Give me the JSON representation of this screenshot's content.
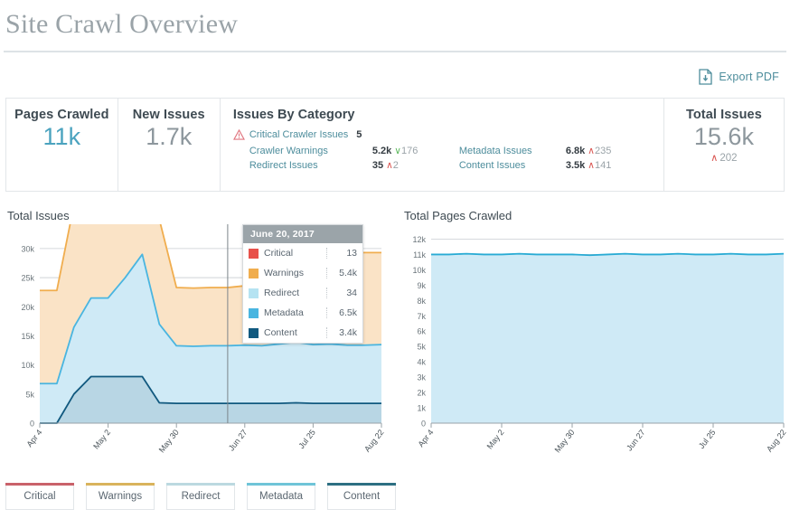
{
  "header": {
    "title": "Site Crawl Overview",
    "export_label": "Export PDF",
    "export_icon": "document-download-icon"
  },
  "stats": {
    "pages_crawled": {
      "label": "Pages Crawled",
      "value": "11k"
    },
    "new_issues": {
      "label": "New Issues",
      "value": "1.7k"
    },
    "total_issues": {
      "label": "Total Issues",
      "value": "15.6k",
      "delta": "202",
      "delta_dir": "up",
      "delta_caret": "∧"
    },
    "category": {
      "title": "Issues By Category",
      "critical": {
        "icon": "warning-triangle-icon",
        "label": "Critical Crawler Issues",
        "value": "5"
      },
      "rows": [
        {
          "label": "Crawler Warnings",
          "value": "5.2k",
          "delta": "176",
          "delta_dir": "down",
          "caret": "∨"
        },
        {
          "label": "Metadata Issues",
          "value": "6.8k",
          "delta": "235",
          "delta_dir": "up",
          "caret": "∧"
        },
        {
          "label": "Redirect Issues",
          "value": "35",
          "delta": "2",
          "delta_dir": "up",
          "caret": "∧"
        },
        {
          "label": "Content Issues",
          "value": "3.5k",
          "delta": "141",
          "delta_dir": "up",
          "caret": "∧"
        }
      ]
    }
  },
  "tooltip": {
    "date": "June 20, 2017",
    "rows": [
      {
        "name": "Critical",
        "value": "13",
        "color": "#e8514a"
      },
      {
        "name": "Warnings",
        "value": "5.4k",
        "color": "#f0ad4e"
      },
      {
        "name": "Redirect",
        "value": "34",
        "color": "#b5e3f2"
      },
      {
        "name": "Metadata",
        "value": "6.5k",
        "color": "#49b5e0"
      },
      {
        "name": "Content",
        "value": "3.4k",
        "color": "#11597f"
      }
    ]
  },
  "legend": [
    {
      "label": "Critical",
      "color": "#c9626a"
    },
    {
      "label": "Warnings",
      "color": "#d9b35c"
    },
    {
      "label": "Redirect",
      "color": "#bcd9e0"
    },
    {
      "label": "Metadata",
      "color": "#6fc4d8"
    },
    {
      "label": "Content",
      "color": "#2d6f82"
    }
  ],
  "chart_data": [
    {
      "id": "total_issues_chart",
      "type": "area",
      "title": "Total Issues",
      "xlabel": "",
      "ylabel": "",
      "grid": true,
      "legend_position": "bottom",
      "stacked": true,
      "ylim": [
        0,
        32000
      ],
      "yticks": [
        "0",
        "5k",
        "10k",
        "15k",
        "20k",
        "25k",
        "30k"
      ],
      "ytick_values": [
        0,
        5000,
        10000,
        15000,
        20000,
        25000,
        30000
      ],
      "xticks": [
        "Apr 4",
        "May 2",
        "May 30",
        "Jun 27",
        "Jul 25",
        "Aug 22"
      ],
      "x": [
        "Apr 4",
        "Apr 11",
        "Apr 18",
        "Apr 25",
        "May 2",
        "May 9",
        "May 16",
        "May 23",
        "May 30",
        "Jun 6",
        "Jun 13",
        "Jun 20",
        "Jun 27",
        "Jul 4",
        "Jul 11",
        "Jul 18",
        "Jul 25",
        "Aug 1",
        "Aug 8",
        "Aug 15",
        "Aug 22"
      ],
      "series": [
        {
          "name": "Content",
          "color": "#11597f",
          "fill": "#b8d6e4",
          "values": [
            0,
            0,
            5000,
            8000,
            8000,
            8000,
            8000,
            3500,
            3400,
            3400,
            3400,
            3400,
            3400,
            3400,
            3400,
            3500,
            3400,
            3400,
            3400,
            3400,
            3400
          ]
        },
        {
          "name": "Metadata",
          "color": "#49b5e0",
          "fill": "#cfeaf6",
          "values": [
            6800,
            6800,
            11500,
            13500,
            13500,
            17000,
            21000,
            13500,
            9900,
            9800,
            9900,
            9900,
            10000,
            9900,
            10200,
            10400,
            10100,
            10200,
            10000,
            10000,
            10100
          ]
        },
        {
          "name": "Warnings",
          "color": "#f0ad4e",
          "fill": "#fae3c6",
          "values": [
            16000,
            16000,
            21000,
            24500,
            24500,
            25000,
            30500,
            18000,
            10000,
            10000,
            10000,
            10000,
            10200,
            10200,
            15800,
            16200,
            16200,
            16000,
            15800,
            15900,
            15800
          ]
        }
      ],
      "tooltip_x": "Jun 20",
      "annotations": {
        "tooltip_date": "June 20, 2017"
      }
    },
    {
      "id": "total_pages_crawled_chart",
      "type": "area",
      "title": "Total Pages Crawled",
      "xlabel": "",
      "ylabel": "",
      "grid": true,
      "ylim": [
        0,
        12500
      ],
      "yticks": [
        "0",
        "1k",
        "2k",
        "3k",
        "4k",
        "5k",
        "6k",
        "7k",
        "8k",
        "9k",
        "10k",
        "11k",
        "12k"
      ],
      "ytick_values": [
        0,
        1000,
        2000,
        3000,
        4000,
        5000,
        6000,
        7000,
        8000,
        9000,
        10000,
        11000,
        12000
      ],
      "xticks": [
        "Apr 4",
        "May 2",
        "May 30",
        "Jun 27",
        "Jul 25",
        "Aug 22"
      ],
      "x": [
        "Apr 4",
        "Apr 11",
        "Apr 18",
        "Apr 25",
        "May 2",
        "May 9",
        "May 16",
        "May 23",
        "May 30",
        "Jun 6",
        "Jun 13",
        "Jun 20",
        "Jun 27",
        "Jul 4",
        "Jul 11",
        "Jul 18",
        "Jul 25",
        "Aug 1",
        "Aug 8",
        "Aug 15",
        "Aug 22"
      ],
      "series": [
        {
          "name": "Pages Crawled",
          "color": "#29abd4",
          "fill": "#cfeaf6",
          "values": [
            11000,
            11000,
            11050,
            11000,
            11000,
            11050,
            11000,
            11000,
            11000,
            10950,
            11000,
            11050,
            11000,
            11000,
            11050,
            11000,
            11000,
            11050,
            11000,
            11000,
            11050
          ]
        }
      ]
    }
  ]
}
